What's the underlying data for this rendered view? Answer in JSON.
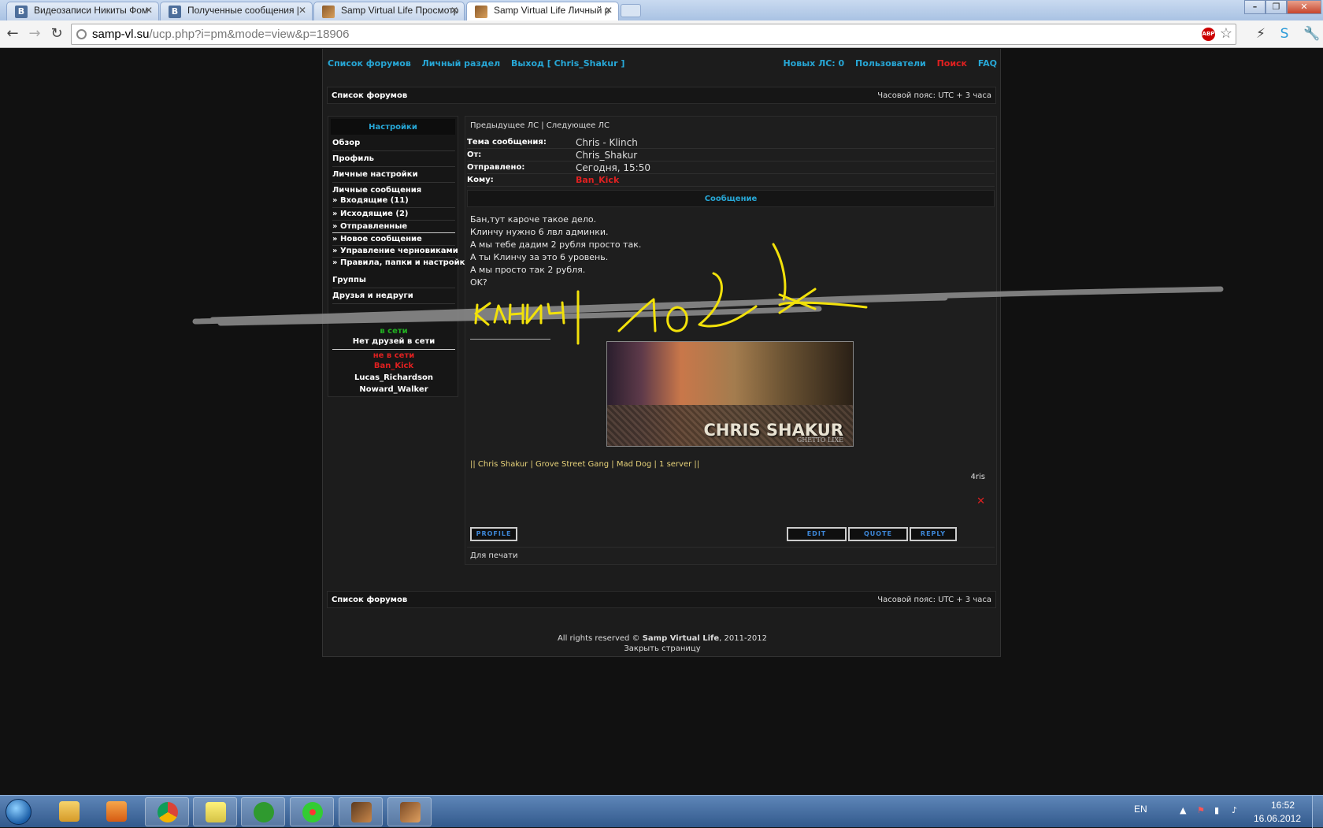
{
  "browser": {
    "tabs": [
      {
        "title": "Видеозаписи Никиты Фом",
        "icon": "vk"
      },
      {
        "title": "Полученные сообщения |",
        "icon": "vk"
      },
      {
        "title": "Samp Virtual Life Просмотр",
        "icon": "samp"
      },
      {
        "title": "Samp Virtual Life Личный р",
        "icon": "samp"
      }
    ],
    "url_host": "samp-vl.su",
    "url_path": "/ucp.php?i=pm&mode=view&p=18906",
    "abp_label": "ABP"
  },
  "forum": {
    "top_left": [
      "Список форумов",
      "Личный раздел",
      "Выход [ Chris_Shakur ]"
    ],
    "top_right": {
      "new_pm": "Новых ЛС: 0",
      "users": "Пользователи",
      "search": "Поиск",
      "faq": "FAQ"
    },
    "crumb": "Список форумов",
    "timezone": "Часовой пояс: UTC + 3 часа",
    "sidebar": {
      "title": "Настройки",
      "items": [
        "Обзор",
        "Профиль",
        "Личные настройки",
        "Личные сообщения"
      ],
      "pm_sub": [
        "Входящие (11)",
        "Исходящие (2)",
        "Отправленные",
        "Новое сообщение",
        "Управление черновиками",
        "Правила, папки и настройки"
      ],
      "groups": "Группы",
      "friends": "Друзья и недруги",
      "online": "в сети",
      "no_friends": "Нет друзей в сети",
      "offline": "не в сети",
      "offline_list": [
        "Ban_Kick",
        "Lucas_Richardson",
        "Noward_Walker"
      ]
    },
    "pm": {
      "nav": "Предыдущее ЛС | Следующее ЛС",
      "subject_label": "Тема сообщения:",
      "subject": "Chris - Klinch",
      "from_label": "От:",
      "from": "Chris_Shakur",
      "sent_label": "Отправлено:",
      "sent": "Сегодня, 15:50",
      "to_label": "Кому:",
      "to": "Ban_Kick",
      "message_header": "Сообщение",
      "body": [
        "Бан,тут кароче такое дело.",
        "Клинчу нужно 6 лвл админки.",
        "А мы тебе дадим 2 рубля просто так.",
        "А ты Клинчу за это 6 уровень.",
        "А мы просто так 2 рубля.",
        "OK?"
      ],
      "signature_image_text": "CHRIS SHAKUR",
      "signature_image_sub": "GHETTO LIXE",
      "signature_text": "|| Chris Shakur | Grove Street Gang | Mad Dog | 1 server ||",
      "signature_name": "4ris",
      "buttons": {
        "profile": "PROFILE",
        "edit": "EDIT",
        "quote": "QUOTE",
        "reply": "REPLY"
      },
      "print": "Для печати"
    },
    "footer": {
      "rights_prefix": "All rights reserved © ",
      "site": "Samp Virtual Life",
      "years": ", 2011-2012",
      "close": "Закрыть страницу"
    }
  },
  "taskbar": {
    "lang": "EN",
    "time": "16:52",
    "date": "16.06.2012"
  },
  "colors": {
    "accent": "#27a7d6",
    "alert": "#e02020",
    "scribble": "#f2e10a"
  }
}
